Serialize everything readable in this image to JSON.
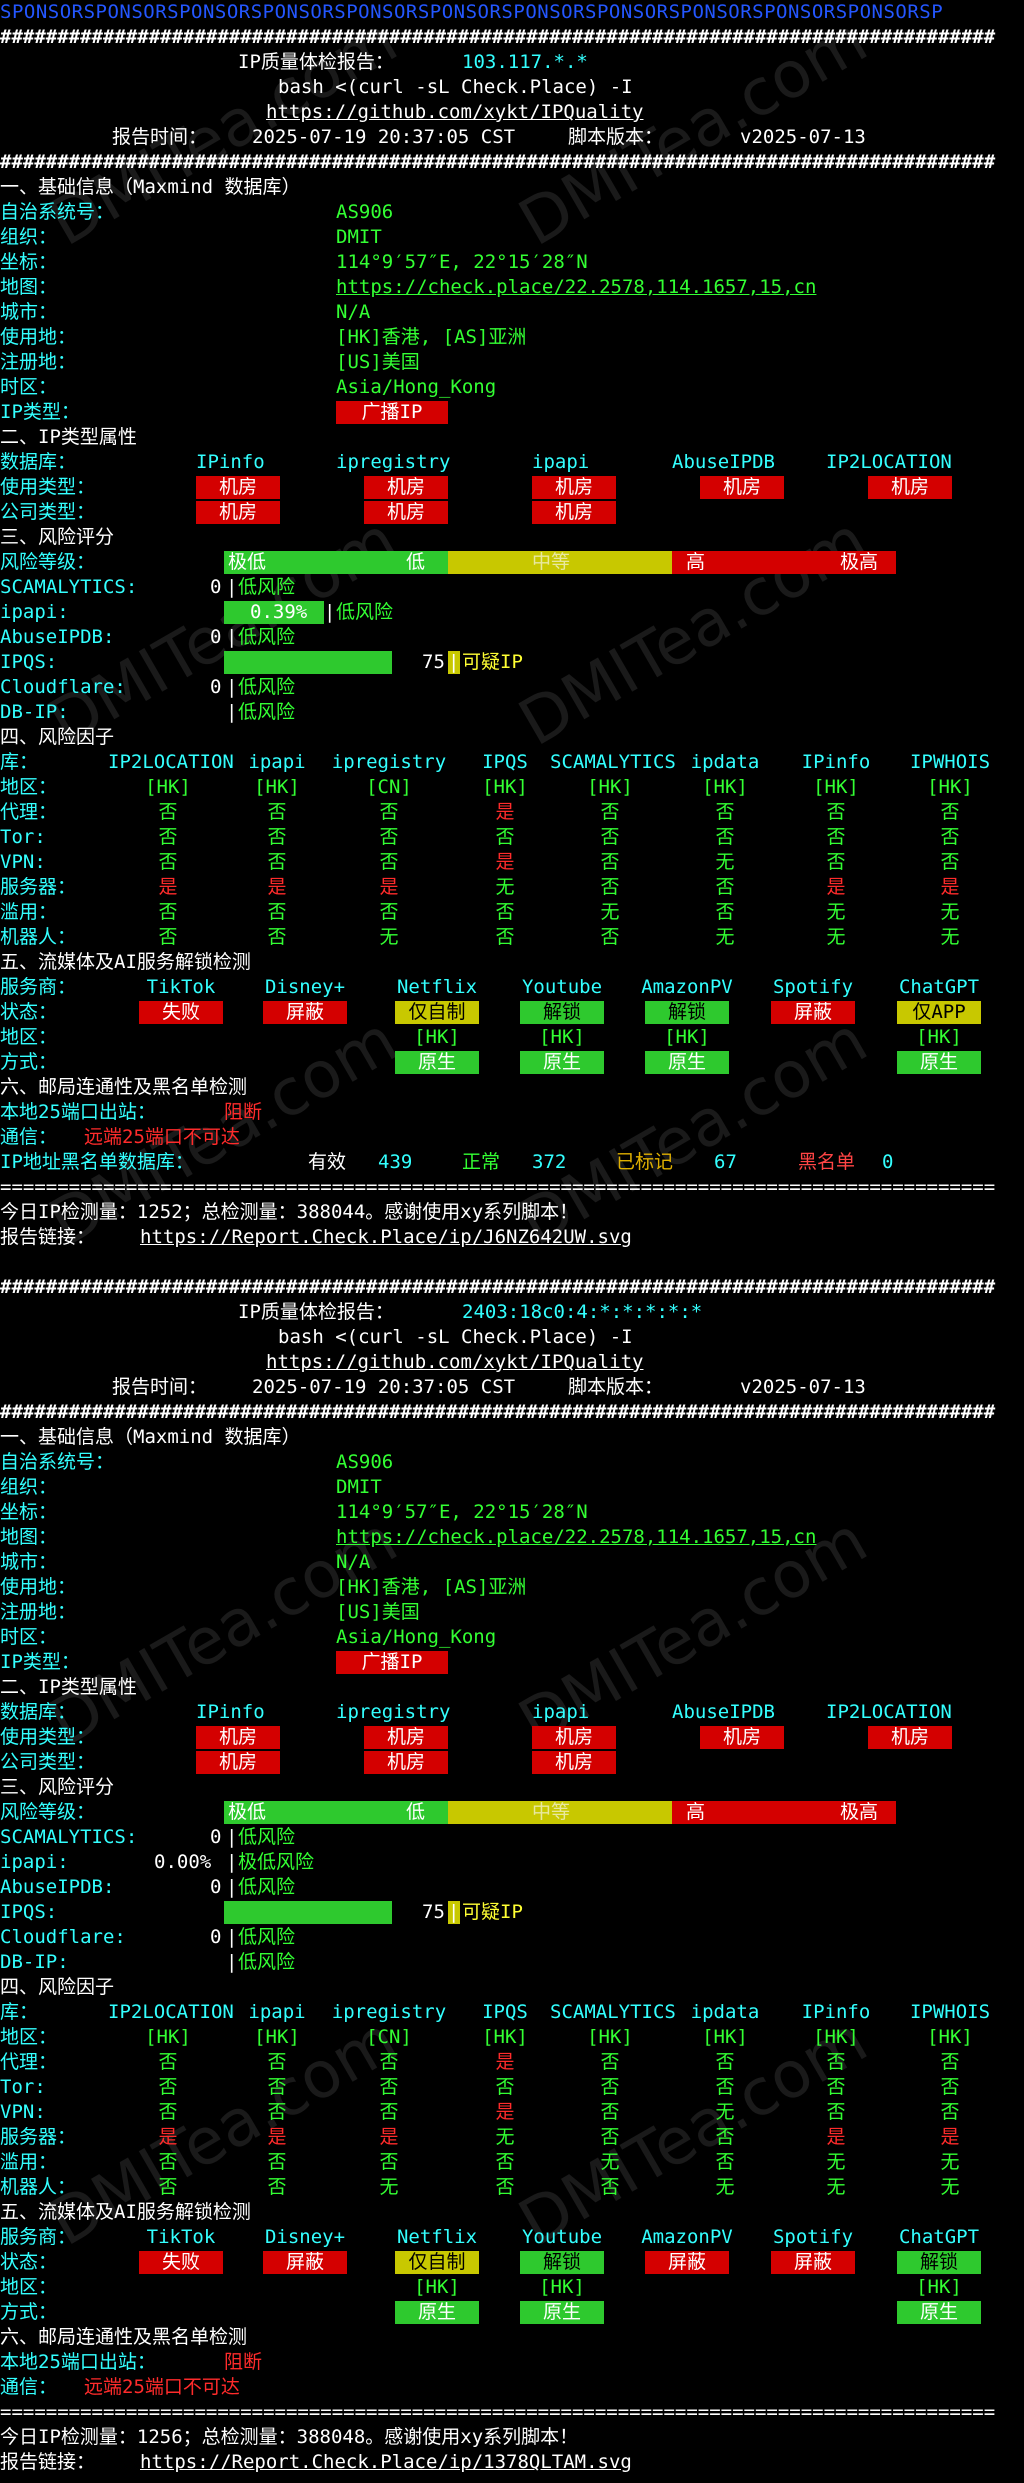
{
  "sponsor_line": "SPONSORSPONSORSPONSORSPONSORSPONSORSPONSORSPONSORSPONSORSPONSORSPONSORSPONSORSP",
  "hash_line": "#######################################################################################",
  "eq_line": "=======================================================================================",
  "watermark": "DMITea.com",
  "header": {
    "title_prefix": "IP质量体检报告：",
    "cmd": "bash <(curl -sL Check.Place) -I",
    "repo_url": "https://github.com/xykt/IPQuality",
    "time_label": "报告时间：",
    "time_value": "2025-07-19 20:37:05 CST",
    "version_label": "脚本版本：",
    "version_value": "v2025-07-13"
  },
  "labels": {
    "s1": "一、基础信息（Maxmind 数据库）",
    "asn": "自治系统号：",
    "org": "组织：",
    "coord": "坐标：",
    "map": "地图：",
    "city": "城市：",
    "usage_loc": "使用地：",
    "reg_loc": "注册地：",
    "tz": "时区：",
    "iptype": "IP类型：",
    "s2": "二、IP类型属性",
    "db": "数据库：",
    "use_type": "使用类型：",
    "comp_type": "公司类型：",
    "s3": "三、风险评分",
    "risk_level": "风险等级：",
    "scam": "SCAMALYTICS:",
    "ipapi": "ipapi:",
    "abuse": "AbuseIPDB:",
    "ipqs": "IPQS:",
    "cf": "Cloudflare:",
    "dbip": "DB-IP:",
    "s4": "四、风险因子",
    "lib": "库：",
    "region": "地区：",
    "proxy": "代理：",
    "tor": "Tor:",
    "vpn": "VPN:",
    "server": "服务器：",
    "abusef": "滥用：",
    "robot": "机器人：",
    "s5": "五、流媒体及AI服务解锁检测",
    "service": "服务商：",
    "status": "状态：",
    "sregion": "地区：",
    "method": "方式：",
    "s6": "六、邮局连通性及黑名单检测",
    "port25": "本地25端口出站：",
    "comm": "通信：",
    "bl": "IP地址黑名单数据库：",
    "bl_valid": "有效",
    "bl_normal": "正常",
    "bl_marked": "已标记",
    "bl_black": "黑名单",
    "today": "今日IP检测量：",
    "total": "总检测量：",
    "thanks": "感谢使用xy系列脚本！",
    "report_link": "报告链接："
  },
  "type_cols": [
    "IPinfo",
    "ipregistry",
    "ipapi",
    "AbuseIPDB",
    "IP2LOCATION"
  ],
  "risk_scale": [
    "极低",
    "低",
    "中等",
    "高",
    "极高"
  ],
  "factor_cols": [
    "IP2LOCATION",
    "ipapi",
    "ipregistry",
    "IPQS",
    "SCAMALYTICS",
    "ipdata",
    "IPinfo",
    "IPWHOIS"
  ],
  "factor_rows": [
    [
      "[HK]",
      "[HK]",
      "[CN]",
      "[HK]",
      "[HK]",
      "[HK]",
      "[HK]",
      "[HK]"
    ],
    [
      "否",
      "否",
      "否",
      "是",
      "否",
      "否",
      "否",
      "否"
    ],
    [
      "否",
      "否",
      "否",
      "否",
      "否",
      "否",
      "否",
      "否"
    ],
    [
      "否",
      "否",
      "否",
      "是",
      "否",
      "无",
      "否",
      "否"
    ],
    [
      "是",
      "是",
      "是",
      "无",
      "否",
      "否",
      "是",
      "是"
    ],
    [
      "否",
      "否",
      "否",
      "否",
      "无",
      "否",
      "无",
      "无"
    ],
    [
      "否",
      "否",
      "无",
      "否",
      "否",
      "无",
      "无",
      "无"
    ]
  ],
  "services": [
    "TikTok",
    "Disney+",
    "Netflix",
    "Youtube",
    "AmazonPV",
    "Spotify",
    "ChatGPT"
  ],
  "reports": [
    {
      "ip": "103.117.*.*",
      "asn": "AS906",
      "org": "DMIT",
      "coord": "114°9′57″E, 22°15′28″N",
      "map_url": "https://check.place/22.2578,114.1657,15,cn",
      "city": "N/A",
      "usage": "[HK]香港, [AS]亚洲",
      "reg": "[US]美国",
      "tz": "Asia/Hong_Kong",
      "iptype": "广播IP",
      "use_types": [
        "机房",
        "机房",
        "机房",
        "机房",
        "机房"
      ],
      "comp_types": [
        "机房",
        "机房",
        "机房"
      ],
      "scam": {
        "score": "0",
        "text": "低风险"
      },
      "ipapi": {
        "score": "0.39%",
        "text": "低风险",
        "bar": 0.39
      },
      "abuse": {
        "score": "0",
        "text": "低风险"
      },
      "ipqs": {
        "score": "75",
        "text": "可疑IP",
        "bar": 75
      },
      "cf": {
        "score": "0",
        "text": "低风险"
      },
      "dbip": {
        "text": "低风险"
      },
      "stream_status": [
        "失败",
        "屏蔽",
        "仅自制",
        "解锁",
        "解锁",
        "屏蔽",
        "仅APP"
      ],
      "stream_region": [
        "",
        "",
        "[HK]",
        "[HK]",
        "[HK]",
        "",
        "[HK]"
      ],
      "stream_method": [
        "",
        "",
        "原生",
        "原生",
        "原生",
        "",
        "原生"
      ],
      "port25": "阻断",
      "comm": "远端25端口不可达",
      "bl_valid": "439",
      "bl_normal": "372",
      "bl_marked": "67",
      "bl_black": "0",
      "today": "1252",
      "total": "388044",
      "report_url": "https://Report.Check.Place/ip/J6NZ642UW.svg"
    },
    {
      "ip": "2403:18c0:4:*:*:*:*:*",
      "asn": "AS906",
      "org": "DMIT",
      "coord": "114°9′57″E, 22°15′28″N",
      "map_url": "https://check.place/22.2578,114.1657,15,cn",
      "city": "N/A",
      "usage": "[HK]香港, [AS]亚洲",
      "reg": "[US]美国",
      "tz": "Asia/Hong_Kong",
      "iptype": "广播IP",
      "use_types": [
        "机房",
        "机房",
        "机房",
        "机房",
        "机房"
      ],
      "comp_types": [
        "机房",
        "机房",
        "机房"
      ],
      "scam": {
        "score": "0",
        "text": "低风险"
      },
      "ipapi": {
        "score": "0.00%",
        "text": "极低风险",
        "bar": 0
      },
      "abuse": {
        "score": "0",
        "text": "低风险"
      },
      "ipqs": {
        "score": "75",
        "text": "可疑IP",
        "bar": 75
      },
      "cf": {
        "score": "0",
        "text": "低风险"
      },
      "dbip": {
        "text": "低风险"
      },
      "stream_status": [
        "失败",
        "屏蔽",
        "仅自制",
        "解锁",
        "屏蔽",
        "屏蔽",
        "解锁"
      ],
      "stream_region": [
        "",
        "",
        "[HK]",
        "[HK]",
        "",
        "",
        "[HK]"
      ],
      "stream_method": [
        "",
        "",
        "原生",
        "原生",
        "",
        "",
        "原生"
      ],
      "port25": "阻断",
      "comm": "远端25端口不可达",
      "today": "1256",
      "total": "388048",
      "report_url": "https://Report.Check.Place/ip/1378QLTAM.svg"
    }
  ]
}
